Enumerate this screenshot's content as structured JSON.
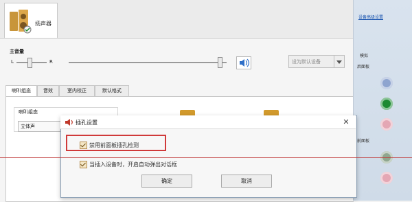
{
  "speaker_tab": {
    "label": "扬声器"
  },
  "master_volume": {
    "title": "主音量",
    "left_label": "L",
    "right_label": "R"
  },
  "default_device_button": {
    "label": "设为默认设备"
  },
  "subtabs": [
    {
      "label": "喇叭组态"
    },
    {
      "label": "音效"
    },
    {
      "label": "室内校正"
    },
    {
      "label": "默认格式"
    }
  ],
  "speaker_config": {
    "group_title": "喇叭组态",
    "selected_value": "立体声"
  },
  "right_panel": {
    "advanced_link": "设备高级设置",
    "analog_label": "模拟",
    "rear_panel_label": "后面板",
    "front_panel_label": "前面板",
    "jack_colors": [
      "#8ea4cf",
      "#1d8a32",
      "#e4a7b4",
      "#8fa78f",
      "#e4a7b4"
    ]
  },
  "dialog": {
    "title": "插孔设置",
    "checkbox_disable_front_detection": "禁用前面板插孔检测",
    "checkbox_auto_popup": "当插入设备时，开启自动弹出对话框",
    "ok_label": "确定",
    "cancel_label": "取消"
  },
  "colors": {
    "highlight": "#d03a3a",
    "link": "#1a55b0"
  }
}
